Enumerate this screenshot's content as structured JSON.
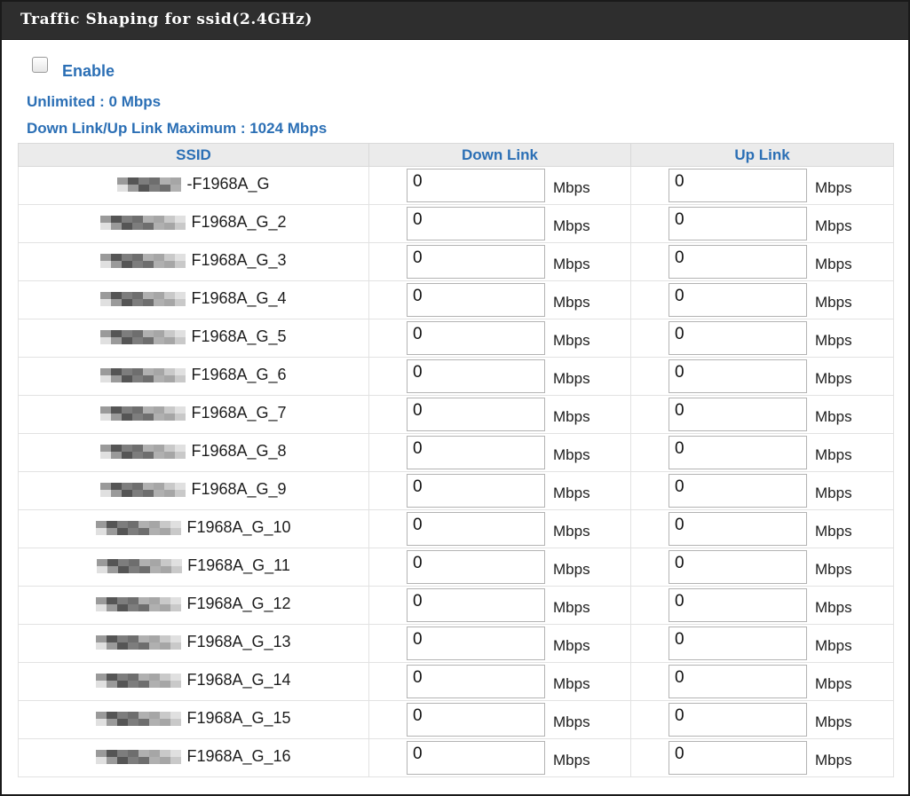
{
  "panel": {
    "title": "Traffic Shaping for ssid(2.4GHz)",
    "enable_label": "Enable",
    "enable_checked": false,
    "info_unlimited": "Unlimited : 0 Mbps",
    "info_maximum": "Down Link/Up Link Maximum : 1024 Mbps"
  },
  "table": {
    "headers": [
      "SSID",
      "Down Link",
      "Up Link"
    ],
    "unit": "Mbps",
    "rows": [
      {
        "ssid_suffix": "-F1968A_G",
        "down": "0",
        "up": "0"
      },
      {
        "ssid_suffix": "F1968A_G_2",
        "down": "0",
        "up": "0"
      },
      {
        "ssid_suffix": "F1968A_G_3",
        "down": "0",
        "up": "0"
      },
      {
        "ssid_suffix": "F1968A_G_4",
        "down": "0",
        "up": "0"
      },
      {
        "ssid_suffix": "F1968A_G_5",
        "down": "0",
        "up": "0"
      },
      {
        "ssid_suffix": "F1968A_G_6",
        "down": "0",
        "up": "0"
      },
      {
        "ssid_suffix": "F1968A_G_7",
        "down": "0",
        "up": "0"
      },
      {
        "ssid_suffix": "F1968A_G_8",
        "down": "0",
        "up": "0"
      },
      {
        "ssid_suffix": "F1968A_G_9",
        "down": "0",
        "up": "0"
      },
      {
        "ssid_suffix": "F1968A_G_10",
        "down": "0",
        "up": "0"
      },
      {
        "ssid_suffix": "F1968A_G_11",
        "down": "0",
        "up": "0"
      },
      {
        "ssid_suffix": "F1968A_G_12",
        "down": "0",
        "up": "0"
      },
      {
        "ssid_suffix": "F1968A_G_13",
        "down": "0",
        "up": "0"
      },
      {
        "ssid_suffix": "F1968A_G_14",
        "down": "0",
        "up": "0"
      },
      {
        "ssid_suffix": "F1968A_G_15",
        "down": "0",
        "up": "0"
      },
      {
        "ssid_suffix": "F1968A_G_16",
        "down": "0",
        "up": "0"
      }
    ]
  },
  "colors": {
    "title_bar": "#2e2e2e",
    "accent_text": "#2b6fb5",
    "header_bg": "#ebebeb"
  }
}
